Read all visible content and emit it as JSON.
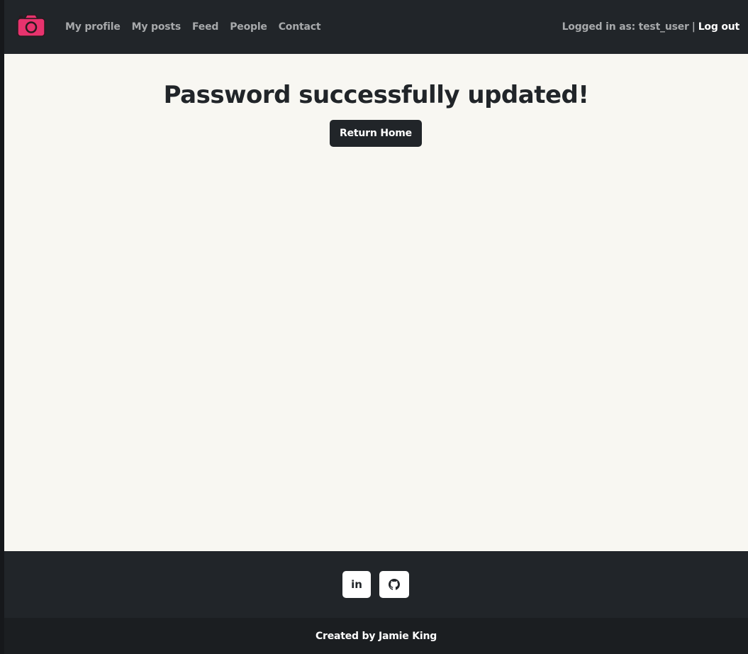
{
  "navbar": {
    "logo_icon": "camera-icon",
    "brand_color": "#e8336e",
    "links": [
      {
        "label": "My profile"
      },
      {
        "label": "My posts"
      },
      {
        "label": "Feed"
      },
      {
        "label": "People"
      },
      {
        "label": "Contact"
      }
    ],
    "logged_in_label": "Logged in as: test_user",
    "separator": "|",
    "logout_label": "Log out"
  },
  "main": {
    "heading": "Password successfully updated!",
    "return_button_label": "Return Home"
  },
  "footer": {
    "linkedin_icon": "linkedin-icon",
    "linkedin_text": "in",
    "github_icon": "github-icon",
    "credit": "Created by Jamie King"
  },
  "colors": {
    "dark": "#212529",
    "background": "#f8f7f2",
    "muted_text": "#a7a9ab"
  }
}
